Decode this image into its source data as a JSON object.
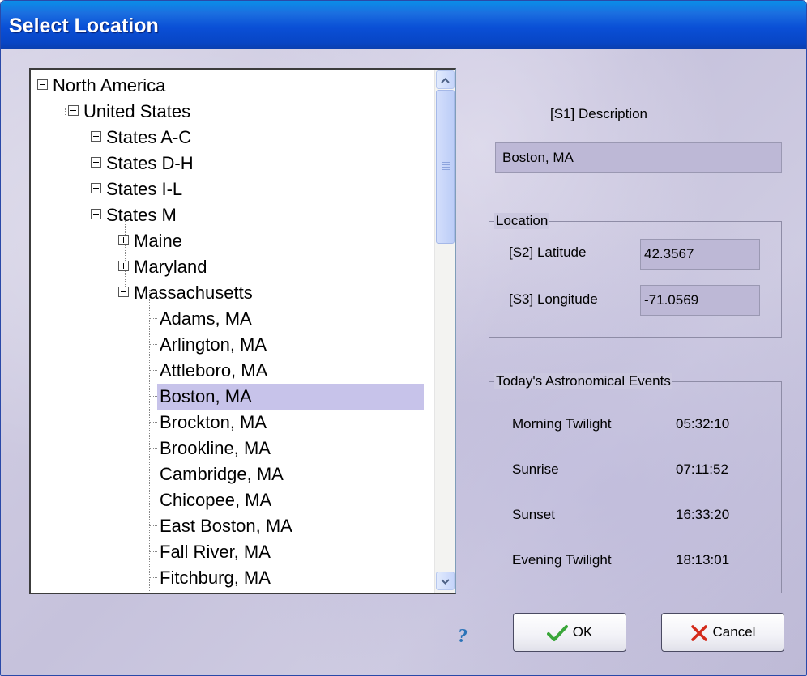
{
  "window": {
    "title": "Select Location"
  },
  "tree": {
    "items": [
      {
        "label": "North America",
        "toggle": "minus"
      },
      {
        "label": "United States",
        "toggle": "minus"
      },
      {
        "label": "States A-C",
        "toggle": "plus"
      },
      {
        "label": "States D-H",
        "toggle": "plus"
      },
      {
        "label": "States I-L",
        "toggle": "plus"
      },
      {
        "label": "States M",
        "toggle": "minus"
      },
      {
        "label": "Maine",
        "toggle": "plus"
      },
      {
        "label": "Maryland",
        "toggle": "plus"
      },
      {
        "label": "Massachusetts",
        "toggle": "minus"
      },
      {
        "label": "Adams, MA"
      },
      {
        "label": "Arlington, MA"
      },
      {
        "label": "Attleboro, MA"
      },
      {
        "label": "Boston, MA",
        "selected": true
      },
      {
        "label": "Brockton, MA"
      },
      {
        "label": "Brookline, MA"
      },
      {
        "label": "Cambridge, MA"
      },
      {
        "label": "Chicopee, MA"
      },
      {
        "label": "East Boston, MA"
      },
      {
        "label": "Fall River, MA"
      },
      {
        "label": "Fitchburg, MA"
      }
    ]
  },
  "description": {
    "label": "[S1] Description",
    "value": "Boston, MA"
  },
  "location": {
    "title": "Location",
    "latitude_label": "[S2] Latitude",
    "latitude_value": "42.3567",
    "longitude_label": "[S3] Longitude",
    "longitude_value": "-71.0569"
  },
  "events": {
    "title": "Today's Astronomical Events",
    "rows": [
      {
        "label": "Morning Twilight",
        "time": "05:32:10"
      },
      {
        "label": "Sunrise",
        "time": "07:11:52"
      },
      {
        "label": "Sunset",
        "time": "16:33:20"
      },
      {
        "label": "Evening Twilight",
        "time": "18:13:01"
      }
    ]
  },
  "buttons": {
    "ok": "OK",
    "cancel": "Cancel",
    "help": "?"
  },
  "colors": {
    "title_bar": "#0a4fd6",
    "selection": "#c7c3ea",
    "ok_check": "#3aa63a",
    "cancel_x": "#d42a1a"
  }
}
